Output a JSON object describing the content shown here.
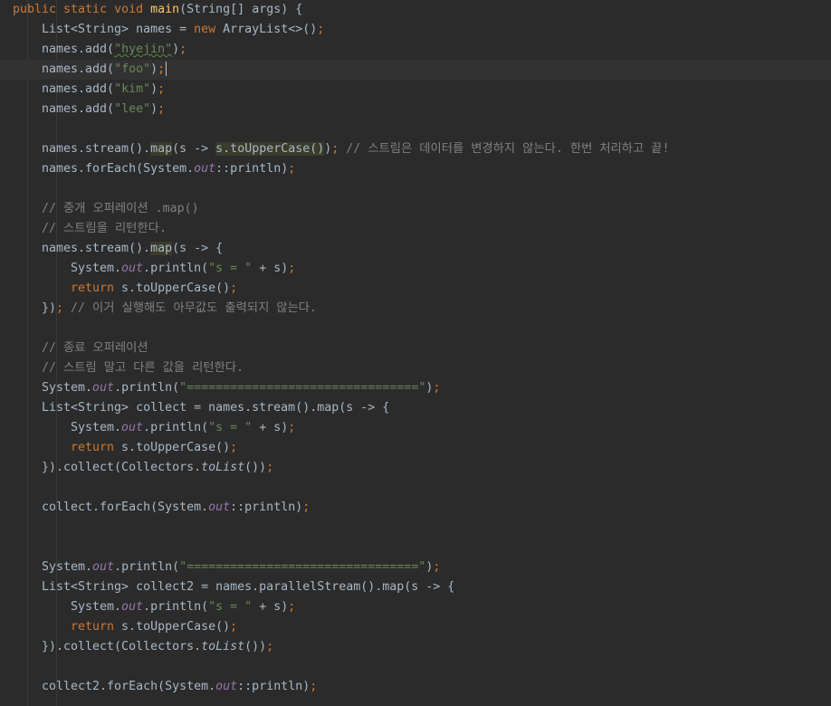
{
  "colors": {
    "background": "#2b2b2b",
    "text": "#a9b7c6",
    "keyword": "#cc7832",
    "method_decl": "#ffc66d",
    "string": "#6a8759",
    "comment": "#808080",
    "static_field": "#9876aa"
  },
  "code": {
    "l1": {
      "kw1": "public static void ",
      "fn": "main",
      "rest": "(String[] args) {"
    },
    "l2": {
      "a": "List<String> names = ",
      "kw": "new",
      "b": " ArrayList<>()",
      "semi": ";"
    },
    "l3": {
      "a": "names.add(",
      "s": "\"hyejin\"",
      "b": ")",
      "semi": ";"
    },
    "l4": {
      "a": "names.add(",
      "s": "\"foo\"",
      "b": ")",
      "semi": ";"
    },
    "l5": {
      "a": "names.add(",
      "s": "\"kim\"",
      "b": ")",
      "semi": ";"
    },
    "l6": {
      "a": "names.add(",
      "s": "\"lee\"",
      "b": ")",
      "semi": ";"
    },
    "l8": {
      "a": "names.stream().",
      "map": "map",
      "b": "(s -> ",
      "hl": "s.toUpperCase()",
      "c": ")",
      "semi": ";",
      "comment": " // 스트림은 데이터를 변경하지 않는다. 한번 처리하고 끝!"
    },
    "l9": {
      "a": "names.forEach(System.",
      "f": "out",
      "b": "::println)",
      "semi": ";"
    },
    "l11": {
      "comment": "// 중개 오퍼레이션 .map()"
    },
    "l12": {
      "comment": "// 스트림을 리턴한다."
    },
    "l13": {
      "a": "names.stream().",
      "map": "map",
      "b": "(s -> {"
    },
    "l14": {
      "a": "System.",
      "f": "out",
      "b": ".println(",
      "s": "\"s = \"",
      "c": " + s)",
      "semi": ";"
    },
    "l15": {
      "kw": "return",
      "a": " s.toUpperCase()",
      "semi": ";"
    },
    "l16": {
      "a": "})",
      "semi": ";",
      "comment": " // 이거 실행해도 아무값도 출력되지 않는다."
    },
    "l18": {
      "comment": "// 종료 오퍼레이션"
    },
    "l19": {
      "comment": "// 스트림 말고 다른 값을 리턴한다."
    },
    "l20": {
      "a": "System.",
      "f": "out",
      "b": ".println(",
      "s": "\"================================\"",
      "c": ")",
      "semi": ";"
    },
    "l21": {
      "a": "List<String> collect = names.stream().map(s -> {"
    },
    "l22": {
      "a": "System.",
      "f": "out",
      "b": ".println(",
      "s": "\"s = \"",
      "c": " + s)",
      "semi": ";"
    },
    "l23": {
      "kw": "return",
      "a": " s.toUpperCase()",
      "semi": ";"
    },
    "l24": {
      "a": "}).collect(Collectors.",
      "it": "toList",
      "b": "())",
      "semi": ";"
    },
    "l26": {
      "a": "collect.forEach(System.",
      "f": "out",
      "b": "::println)",
      "semi": ";"
    },
    "l29": {
      "a": "System.",
      "f": "out",
      "b": ".println(",
      "s": "\"================================\"",
      "c": ")",
      "semi": ";"
    },
    "l30": {
      "a": "List<String> collect2 = names.parallelStream().map(s -> {"
    },
    "l31": {
      "a": "System.",
      "f": "out",
      "b": ".println(",
      "s": "\"s = \"",
      "c": " + s)",
      "semi": ";"
    },
    "l32": {
      "kw": "return",
      "a": " s.toUpperCase()",
      "semi": ";"
    },
    "l33": {
      "a": "}).collect(Collectors.",
      "it": "toList",
      "b": "())",
      "semi": ";"
    },
    "l35": {
      "a": "collect2.forEach(System.",
      "f": "out",
      "b": "::println)",
      "semi": ";"
    }
  }
}
